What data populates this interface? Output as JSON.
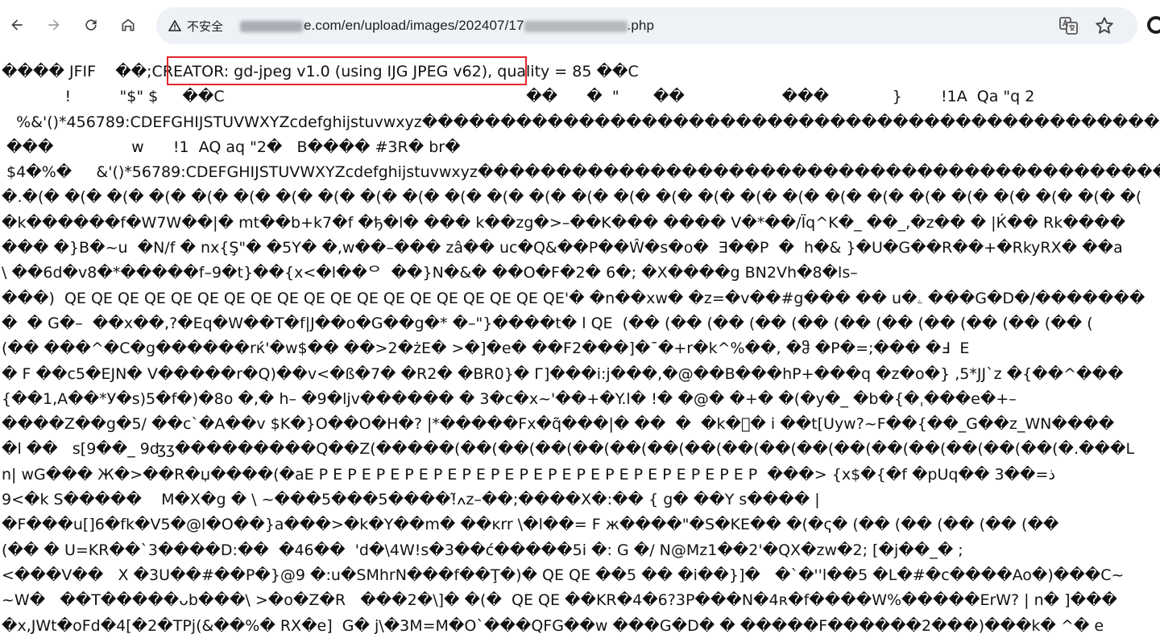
{
  "browser": {
    "security_label": "不安全",
    "url_middle": "e.com/en/upload/images/202407/17",
    "url_end": ".php",
    "icons": {
      "back": "arrow-left-icon",
      "forward": "arrow-right-icon",
      "reload": "reload-icon",
      "home": "home-icon",
      "warning": "warning-triangle-icon",
      "translate": "translate-icon",
      "star": "star-icon"
    }
  },
  "highlight": {
    "color": "#e0282e",
    "text": "CREATOR: gd-jpeg v1.0 (using IJG JPEG v62),"
  },
  "content_lines": [
    "���� JFIF    ��;CREATOR: gd-jpeg v1.0 (using IJG JPEG v62), quality = 85 ��C",
    "             !          \"$\" $     ��C                                                              ��      �  \"       ��                    ���             }        !1A  Qa \"q 2",
    "   %&'()*456789:CDEFGHIJSTUVWXYZcdefghijstuvwxyz������������������������������������������������������������������",
    " ���                w      !1  AQ aq \"2�   B���� #3R� br�",
    " $4�%�     &'()*56789:CDEFGHIJSTUVWXYZcdefghijstuvwxyz������������������������������������������������������������������",
    "�.�(� �(� �(� �(� �(� �(� �(� �(� �(� �(� �(� �(� �(� �(� �(� �(� �(� �(� �(� �(� �(� �(� �(� �(� �(� �(� �(",
    "�k������f�W7W��|� mt��b+k7�f �ђ�l� ��� k��zg�>–��K��� ���� V�*��/Ïq^K�_ ��_,�z�� � |Ќ�� Rk����",
    "��� �}B�~u  �N/f � nx{Ş\"� �5Y� �,w��–��� zâ�� uc�Q&��P��Ŵ�s�o�  Ǝ��P  �  h�& }�U�G��R��+�RkyRX� ��a",
    "\\ ��6d�v8�*�����f–9�t}��{x<�l��ᄋ  ��}N�&� ��O�F�2� 6�; �X����g BN2Vh�8�ls–",
    "���)  QE QE QE QE QE QE QE QE QE QE QE QE QE QE QE QE QE QE QE'� �n��xw� �z=�v��#g��� �� u�ۦ ���G�D�/�������",
    "�  � G�–  ��x��,?�Eq�W��T�f|J��o�G��g�* �–\"}����t� l QE  (�� (�� (�� (�� (�� (�� (�� (�� (�� (�� (�� (",
    "(�� ���^�C�g������rќ'�w$�� ��>2�żE� >�]�e� ��F2���]�¯�+r�k^%��, �ჵ �P�=;��� �Ⅎ  E",
    "� F ��c5�EJN� V�����r�Q)��v<�ß�7� �R2� �BR0}� Г]���i:j���,�@��B���hP+���q �z�o�} ,5*JJ`z �{��^���",
    "{��1,A��*У�s)5�f�)�8o �,� h– �9�ljv������ � 3�c�x~'��+�Y.l� !� �@� �+� �(�y�_ �b�{�ˌ���e�+–",
    "����Z��g�5/ ��c`�A��v $K�}O��O�H�? |*�����Fx�q̃���|� ��  �  �k�ᷓ� i ��t[Uyw?~F��{��_G��z_WN����",
    "�l ��   s[9��_ 9ʤʒ���������Q��Z(�����(��(��(��(��(��(��(��(��(��(��(��(��(��(��(��(��(�.���L",
    "n| wG��� Ж�>��R�џ����(�aE P E P E P E P E P E P E P E P E P E P E P E P E P E P E P E P  ���> {x$�{�f �pUq�� 3��=ذ",
    "9<�k S�����    M�X�g � \\ ~���5���5����!ߍ̃z–��;����X�:�� { g� ��Y s���� |",
    "�F���u[]6�fk�V5�@l�O��}a���>�k�Y��m� ��ĸrr \\�l��= F ж����\"�S�KE�� �(�ҁ� (�� (�� (�� (�� (��",
    "(�� � U=KR��`3����D:��  �46��  'd�\\4W!s�3��ć�����5i �: G �/ N@Mz1��2'�QX�zw�2; [�j��_� ;",
    "<���V��   X �3U��#��P�}@9 �:u�SMhrN���f��Ţ�)� QE QE ��5 �� �i��}]�   �`�''l��5 �L�#�c����Ao�)���C~",
    "~W�   ��T�����ᴗb���\\ >�o�Z�R   ���2�\\]� �(�  QE QE ��KR�4�6?3P���N�4ʀ�f����W%�����ErW? | n� ]���",
    "�x,JWt�oFd�4[�2�TPj(&��%� RX�e]  G� j\\�3M=M�O`���QFG��w ���G�D� � �����F������2���)���k� ^� e"
  ]
}
